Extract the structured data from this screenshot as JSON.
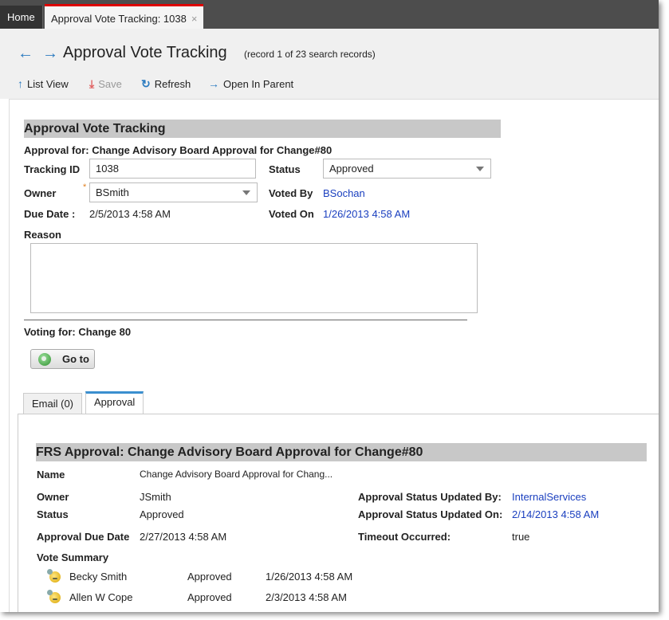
{
  "tabs": {
    "home": "Home",
    "active": "Approval Vote Tracking: 1038",
    "close": "×"
  },
  "header": {
    "title": "Approval Vote Tracking",
    "record_info": "(record 1 of 23 search records)"
  },
  "toolbar": {
    "list_view": "List View",
    "save": "Save",
    "refresh": "Refresh",
    "open_in_parent": "Open In Parent"
  },
  "form": {
    "section_title": "Approval Vote Tracking",
    "approval_for": "Approval for: Change Advisory Board Approval for Change#80",
    "tracking_id_label": "Tracking ID",
    "tracking_id_value": "1038",
    "status_label": "Status",
    "status_value": "Approved",
    "owner_label": "Owner",
    "owner_value": "BSmith",
    "required_marker": "*",
    "voted_by_label": "Voted By",
    "voted_by_value": "BSochan",
    "due_date_label": "Due Date :",
    "due_date_value": "2/5/2013 4:58 AM",
    "voted_on_label": "Voted On",
    "voted_on_value": "1/26/2013 4:58 AM",
    "reason_label": "Reason",
    "reason_value": "",
    "voting_for": "Voting for: Change 80",
    "goto_label": "Go to"
  },
  "subtabs": {
    "email": "Email (0)",
    "approval": "Approval"
  },
  "approval": {
    "section_title": "FRS Approval: Change Advisory Board Approval for Change#80",
    "name_label": "Name",
    "name_value": "Change Advisory Board Approval for Chang...",
    "owner_label": "Owner",
    "owner_value": "JSmith",
    "status_label": "Status",
    "status_value": "Approved",
    "status_updated_by_label": "Approval Status Updated By:",
    "status_updated_by_value": "InternalServices",
    "status_updated_on_label": "Approval Status Updated On:",
    "status_updated_on_value": "2/14/2013 4:58 AM",
    "due_date_label": "Approval Due Date",
    "due_date_value": "2/27/2013 4:58 AM",
    "timeout_label": "Timeout Occurred:",
    "timeout_value": "true",
    "vote_summary_label": "Vote Summary",
    "votes": [
      {
        "name": "Becky Smith",
        "status": "Approved",
        "date": "1/26/2013 4:58 AM"
      },
      {
        "name": "Allen W Cope",
        "status": "Approved",
        "date": "2/3/2013 4:58 AM"
      }
    ]
  },
  "colors": {
    "accent_blue": "#2b7bc0",
    "link_blue": "#1a3fbf",
    "active_tab_red": "#dd0000",
    "section_gray": "#c8c8c8"
  }
}
